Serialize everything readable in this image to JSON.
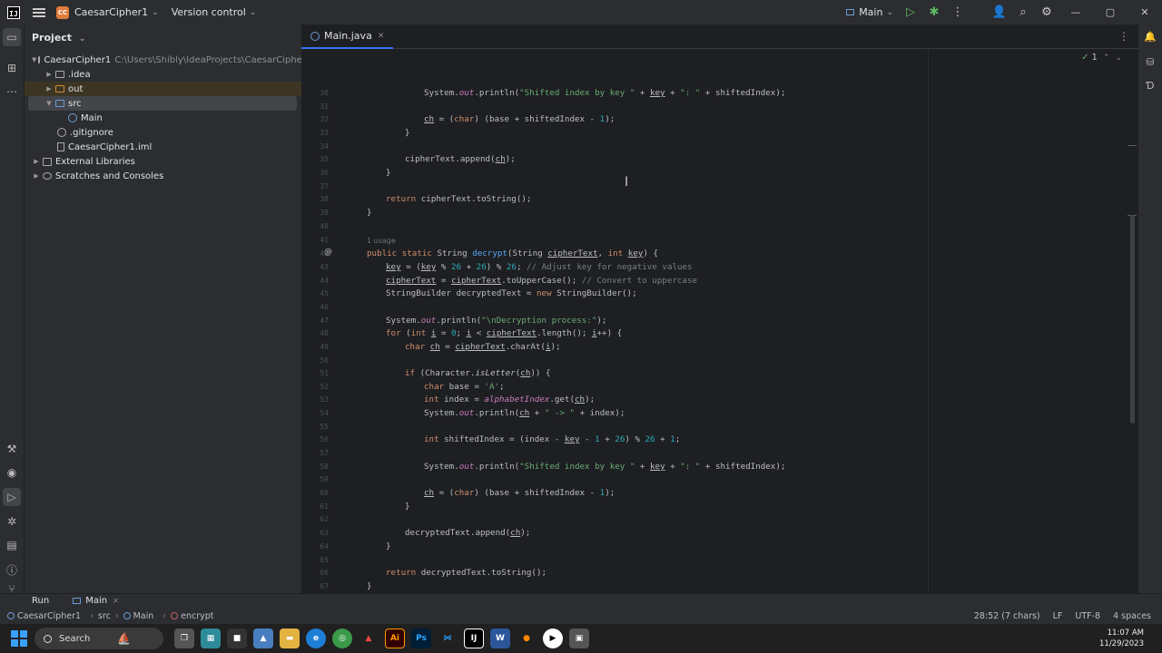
{
  "titlebar": {
    "logo": "IJ",
    "project_badge": "CC",
    "project_name": "CaesarCipher1",
    "vcs_label": "Version control",
    "run_config": "Main"
  },
  "project_panel": {
    "title": "Project",
    "tree": [
      {
        "label": "CaesarCipher1",
        "path": "C:\\Users\\Shibly\\IdeaProjects\\CaesarCipher1"
      },
      {
        "label": ".idea"
      },
      {
        "label": "out"
      },
      {
        "label": "src"
      },
      {
        "label": "Main"
      },
      {
        "label": ".gitignore"
      },
      {
        "label": "CaesarCipher1.iml"
      },
      {
        "label": "External Libraries"
      },
      {
        "label": "Scratches and Consoles"
      }
    ]
  },
  "editor": {
    "tab_label": "Main.java",
    "inspection_count": "1",
    "usage_hint": "1 usage",
    "line_numbers": [
      "30",
      "31",
      "32",
      "33",
      "34",
      "35",
      "36",
      "37",
      "38",
      "39",
      "40",
      "41",
      "42",
      "43",
      "44",
      "45",
      "46",
      "47",
      "48",
      "49",
      "50",
      "51",
      "52",
      "53",
      "54",
      "55",
      "56",
      "57",
      "58",
      "59",
      "60",
      "61",
      "62",
      "63",
      "64",
      "65",
      "66",
      "67"
    ]
  },
  "run_panel": {
    "label": "Run",
    "tab_label": "Main"
  },
  "statusbar": {
    "breadcrumb": [
      "CaesarCipher1",
      "src",
      "Main",
      "encrypt"
    ],
    "position": "28:52 (7 chars)",
    "line_sep": "LF",
    "encoding": "UTF-8",
    "indent": "4 spaces"
  },
  "taskbar": {
    "search_label": "Search",
    "time": "11:07 AM",
    "date": "11/29/2023"
  },
  "colors": {
    "accent": "#3574f0",
    "keyword": "#cf8e6d",
    "string": "#6aab73",
    "number": "#2aacb8"
  }
}
